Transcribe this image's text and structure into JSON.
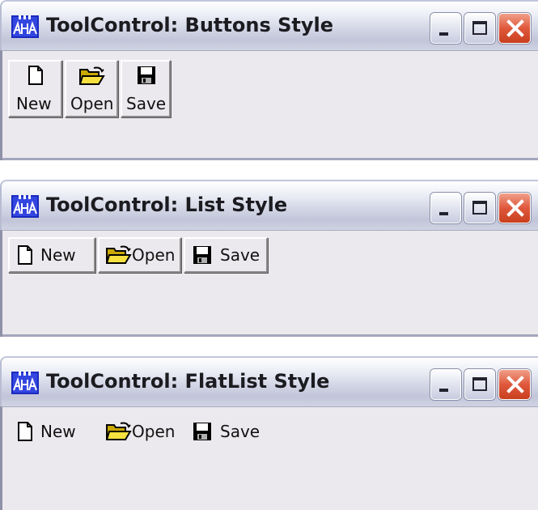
{
  "windows": [
    {
      "title": "ToolControl: Buttons Style",
      "buttons": [
        {
          "label": "New",
          "icon": "new-document-icon"
        },
        {
          "label": "Open",
          "icon": "open-folder-icon"
        },
        {
          "label": "Save",
          "icon": "floppy-disk-icon"
        }
      ]
    },
    {
      "title": "ToolControl: List Style",
      "buttons": [
        {
          "label": "New",
          "icon": "new-document-icon"
        },
        {
          "label": "Open",
          "icon": "open-folder-icon"
        },
        {
          "label": "Save",
          "icon": "floppy-disk-icon"
        }
      ]
    },
    {
      "title": "ToolControl: FlatList Style",
      "buttons": [
        {
          "label": "New",
          "icon": "new-document-icon"
        },
        {
          "label": "Open",
          "icon": "open-folder-icon"
        },
        {
          "label": "Save",
          "icon": "floppy-disk-icon"
        }
      ]
    }
  ],
  "colors": {
    "titlebar": "#d4d7e6",
    "client": "#ebe9ed",
    "close_button": "#e0583c"
  }
}
